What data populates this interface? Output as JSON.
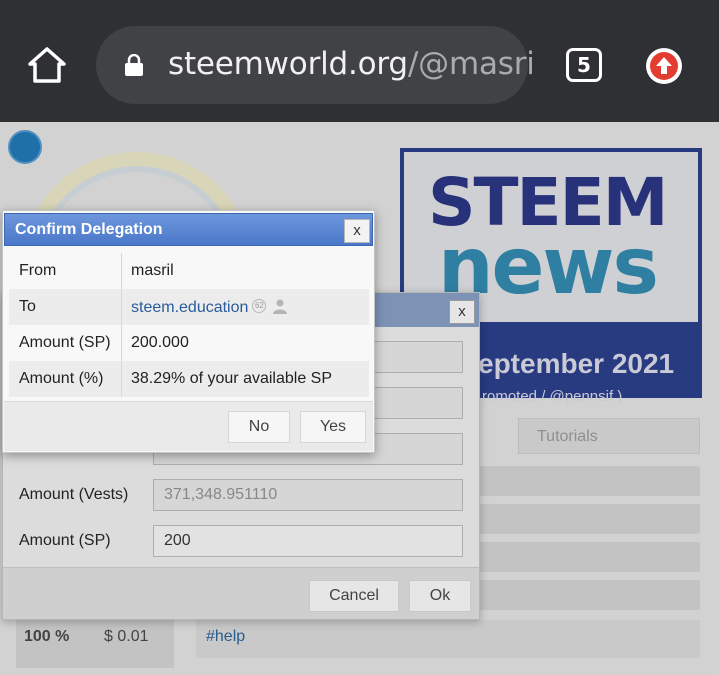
{
  "browser": {
    "url_domain": "steemworld.org",
    "url_path": "/@masri",
    "tab_count": "5",
    "icons": [
      "home-icon",
      "lock-icon",
      "tabs-icon",
      "upload-arrow-icon"
    ]
  },
  "background_page": {
    "banner": {
      "line1": "STEEM",
      "line2": "news",
      "date": "eptember 2021",
      "sub": "romoted / @pennsif )"
    },
    "tutorials_tab": "Tutorials",
    "percent_cell": "100 %",
    "usd_cell": "$ 0.01",
    "help_link": "#help"
  },
  "delegate_dialog": {
    "close_label": "x",
    "amount_vests_label": "Amount (Vests)",
    "amount_vests_value": "371,348.951110",
    "amount_sp_label": "Amount (SP)",
    "amount_sp_value": "200",
    "cancel_label": "Cancel",
    "ok_label": "Ok"
  },
  "confirm_dialog": {
    "title": "Confirm Delegation",
    "close_label": "x",
    "rows": [
      {
        "key": "From",
        "value": "masril"
      },
      {
        "key": "To",
        "value": "steem.education",
        "reputation": "62"
      },
      {
        "key": "Amount (SP)",
        "value": "200.000"
      },
      {
        "key": "Amount (%)",
        "value": "38.29% of your available SP"
      }
    ],
    "no_label": "No",
    "yes_label": "Yes"
  },
  "colors": {
    "titlebar_blue": "#4a78c8",
    "link_blue": "#2a5b9a",
    "browser_bg": "#2e3033"
  }
}
